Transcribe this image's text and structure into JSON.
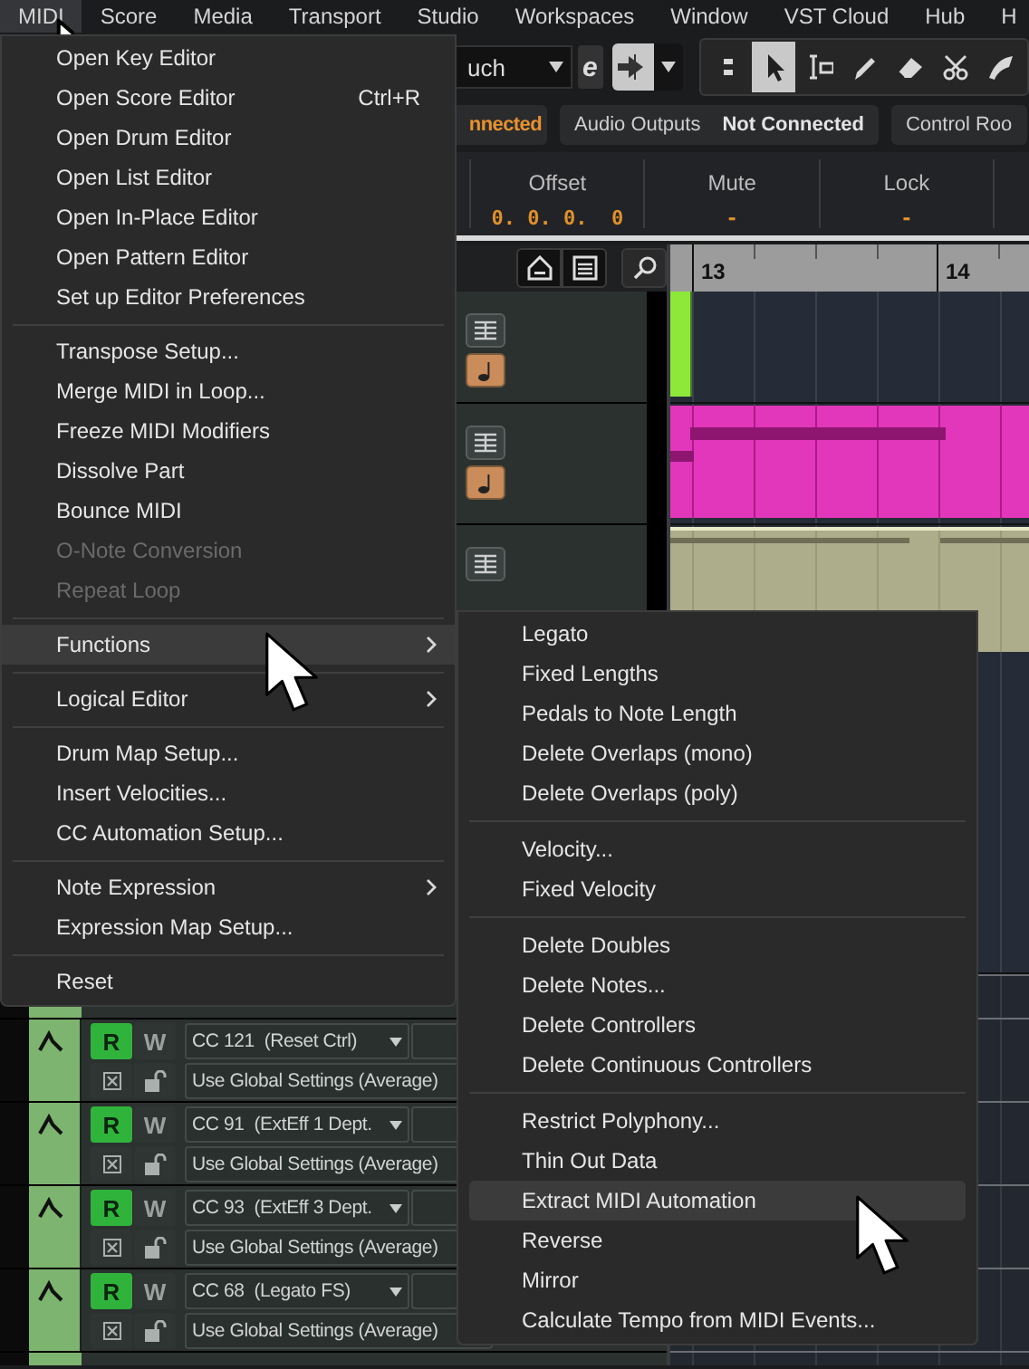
{
  "menubar": [
    {
      "label": "MIDI",
      "selected": true
    },
    {
      "label": "Score",
      "selected": false
    },
    {
      "label": "Media",
      "selected": false
    },
    {
      "label": "Transport",
      "selected": false
    },
    {
      "label": "Studio",
      "selected": false
    },
    {
      "label": "Workspaces",
      "selected": false
    },
    {
      "label": "Window",
      "selected": false
    },
    {
      "label": "VST Cloud",
      "selected": false
    },
    {
      "label": "Hub",
      "selected": false
    },
    {
      "label": "H",
      "selected": false
    }
  ],
  "toolbar": {
    "mode": "uch",
    "edit_button": "e",
    "tools": [
      {
        "kind": "toggle",
        "selected": false
      },
      {
        "kind": "arrow",
        "selected": true
      },
      {
        "kind": "range",
        "selected": false
      },
      {
        "kind": "pencil",
        "selected": false
      },
      {
        "kind": "eraser",
        "selected": false
      },
      {
        "kind": "scissors",
        "selected": false
      },
      {
        "kind": "glue",
        "selected": false
      }
    ]
  },
  "connections": [
    {
      "status": "nnected",
      "kind": "connected"
    },
    {
      "label": "Audio Outputs",
      "status": "Not Connected",
      "kind": "disconnected"
    },
    {
      "label": "Control Roo"
    }
  ],
  "info_line": [
    {
      "header": "Offset",
      "value": "0. 0. 0.  0"
    },
    {
      "header": "Mute",
      "value": "-"
    },
    {
      "header": "Lock",
      "value": "-"
    }
  ],
  "ruler": [
    "13",
    "14"
  ],
  "tracks": [
    {
      "kind": "ending",
      "color": "#8ee83a"
    },
    {
      "kind": "notes",
      "color": "#e236bb"
    },
    {
      "kind": "controller",
      "color": "#adad8c"
    }
  ],
  "lanes": [
    {
      "controller": "CC 121  (Reset Ctrl)",
      "mode": "Use Global Settings (Average)",
      "read_button": "R",
      "write_button": "W",
      "read": true,
      "write": false
    },
    {
      "controller": "CC 91  (ExtEff 1 Dept.",
      "mode": "Use Global Settings (Average)",
      "read_button": "R",
      "write_button": "W",
      "read": true,
      "write": false
    },
    {
      "controller": "CC 93  (ExtEff 3 Dept.",
      "mode": "Use Global Settings (Average)",
      "read_button": "R",
      "write_button": "W",
      "read": true,
      "write": false
    },
    {
      "controller": "CC 68  (Legato FS)",
      "mode": "Use Global Settings (Average)",
      "read_button": "R",
      "write_button": "W",
      "read": true,
      "write": false
    }
  ],
  "midi_menu": [
    {
      "kind": "item",
      "label": "Open Key Editor",
      "selected": false,
      "disabled": false
    },
    {
      "kind": "item",
      "label": "Open Score Editor",
      "shortcut": "Ctrl+R",
      "selected": false,
      "disabled": false
    },
    {
      "kind": "item",
      "label": "Open Drum Editor",
      "selected": false,
      "disabled": false
    },
    {
      "kind": "item",
      "label": "Open List Editor",
      "selected": false,
      "disabled": false
    },
    {
      "kind": "item",
      "label": "Open In-Place Editor",
      "selected": false,
      "disabled": false
    },
    {
      "kind": "item",
      "label": "Open Pattern Editor",
      "selected": false,
      "disabled": false
    },
    {
      "kind": "item",
      "label": "Set up Editor Preferences",
      "selected": false,
      "disabled": false
    },
    {
      "kind": "separator"
    },
    {
      "kind": "item",
      "label": "Transpose Setup...",
      "selected": false,
      "disabled": false
    },
    {
      "kind": "item",
      "label": "Merge MIDI in Loop...",
      "selected": false,
      "disabled": false
    },
    {
      "kind": "item",
      "label": "Freeze MIDI Modifiers",
      "selected": false,
      "disabled": false
    },
    {
      "kind": "item",
      "label": "Dissolve Part",
      "selected": false,
      "disabled": false
    },
    {
      "kind": "item",
      "label": "Bounce MIDI",
      "selected": false,
      "disabled": false
    },
    {
      "kind": "item",
      "label": "O-Note Conversion",
      "selected": false,
      "disabled": true
    },
    {
      "kind": "item",
      "label": "Repeat Loop",
      "selected": false,
      "disabled": true
    },
    {
      "kind": "separator"
    },
    {
      "kind": "submenu",
      "label": "Functions",
      "selected": true,
      "disabled": false
    },
    {
      "kind": "separator"
    },
    {
      "kind": "submenu",
      "label": "Logical Editor",
      "selected": false,
      "disabled": false
    },
    {
      "kind": "separator"
    },
    {
      "kind": "item",
      "label": "Drum Map Setup...",
      "selected": false,
      "disabled": false
    },
    {
      "kind": "item",
      "label": "Insert Velocities...",
      "selected": false,
      "disabled": false
    },
    {
      "kind": "item",
      "label": "CC Automation Setup...",
      "selected": false,
      "disabled": false
    },
    {
      "kind": "separator"
    },
    {
      "kind": "submenu",
      "label": "Note Expression",
      "selected": false,
      "disabled": false
    },
    {
      "kind": "item",
      "label": "Expression Map Setup...",
      "selected": false,
      "disabled": false
    },
    {
      "kind": "separator"
    },
    {
      "kind": "item",
      "label": "Reset",
      "selected": false,
      "disabled": false
    }
  ],
  "functions_submenu": [
    {
      "kind": "item",
      "label": "Legato",
      "selected": false
    },
    {
      "kind": "item",
      "label": "Fixed Lengths",
      "selected": false
    },
    {
      "kind": "item",
      "label": "Pedals to Note Length",
      "selected": false
    },
    {
      "kind": "item",
      "label": "Delete Overlaps (mono)",
      "selected": false
    },
    {
      "kind": "item",
      "label": "Delete Overlaps (poly)",
      "selected": false
    },
    {
      "kind": "separator"
    },
    {
      "kind": "item",
      "label": "Velocity...",
      "selected": false
    },
    {
      "kind": "item",
      "label": "Fixed Velocity",
      "selected": false
    },
    {
      "kind": "separator"
    },
    {
      "kind": "item",
      "label": "Delete Doubles",
      "selected": false
    },
    {
      "kind": "item",
      "label": "Delete Notes...",
      "selected": false
    },
    {
      "kind": "item",
      "label": "Delete Controllers",
      "selected": false
    },
    {
      "kind": "item",
      "label": "Delete Continuous Controllers",
      "selected": false
    },
    {
      "kind": "separator"
    },
    {
      "kind": "item",
      "label": "Restrict Polyphony...",
      "selected": false
    },
    {
      "kind": "item",
      "label": "Thin Out Data",
      "selected": false
    },
    {
      "kind": "item",
      "label": "Extract MIDI Automation",
      "selected": true
    },
    {
      "kind": "item",
      "label": "Reverse",
      "selected": false
    },
    {
      "kind": "item",
      "label": "Mirror",
      "selected": false
    },
    {
      "kind": "item",
      "label": "Calculate Tempo from MIDI Events...",
      "selected": false
    }
  ]
}
